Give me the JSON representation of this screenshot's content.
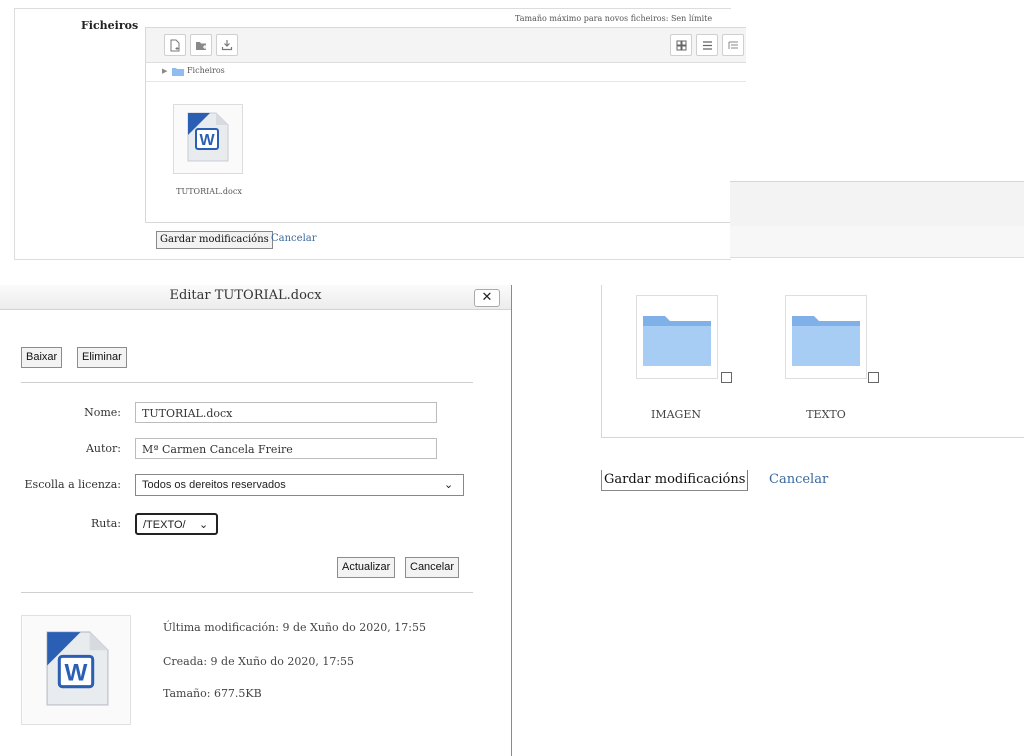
{
  "top_panel": {
    "label": "Ficheiros",
    "max_size": "Tamaño máximo para novos ficheiros: Sen límite",
    "path_label": "Ficheiros",
    "file_name": "TUTORIAL.docx",
    "save_label": "Gardar modificacións",
    "cancel_label": "Cancelar"
  },
  "dialog": {
    "title": "Editar TUTORIAL.docx",
    "close_label": "✕",
    "download_label": "Baixar",
    "delete_label": "Eliminar",
    "fields": {
      "name_label": "Nome:",
      "name_value": "TUTORIAL.docx",
      "author_label": "Autor:",
      "author_value": "Mª Carmen Cancela Freire",
      "license_label": "Escolla a licenza:",
      "license_value": "Todos os dereitos reservados",
      "path_label": "Ruta:",
      "path_value": "/TEXTO/"
    },
    "update_label": "Actualizar",
    "cancel_label": "Cancelar",
    "info": {
      "modified": "Última modificación: 9 de Xuño do 2020, 17:55",
      "created": "Creada: 9 de Xuño do 2020, 17:55",
      "size": "Tamaño: 677.5KB"
    }
  },
  "folder_panel": {
    "folders": [
      "IMAGEN",
      "TEXTO"
    ],
    "save_label": "Gardar modificacións",
    "cancel_label": "Cancelar"
  },
  "colors": {
    "link": "#3a6a9c",
    "folder_blue": "#8fbdf0",
    "word_blue": "#2b5fb4"
  },
  "icons": [
    "new-file-icon",
    "new-folder-icon",
    "download-icon",
    "grid-view-icon",
    "list-view-icon",
    "tree-view-icon",
    "folder-icon",
    "word-document-icon",
    "close-icon",
    "context-menu-icon",
    "chevron-down-icon"
  ]
}
